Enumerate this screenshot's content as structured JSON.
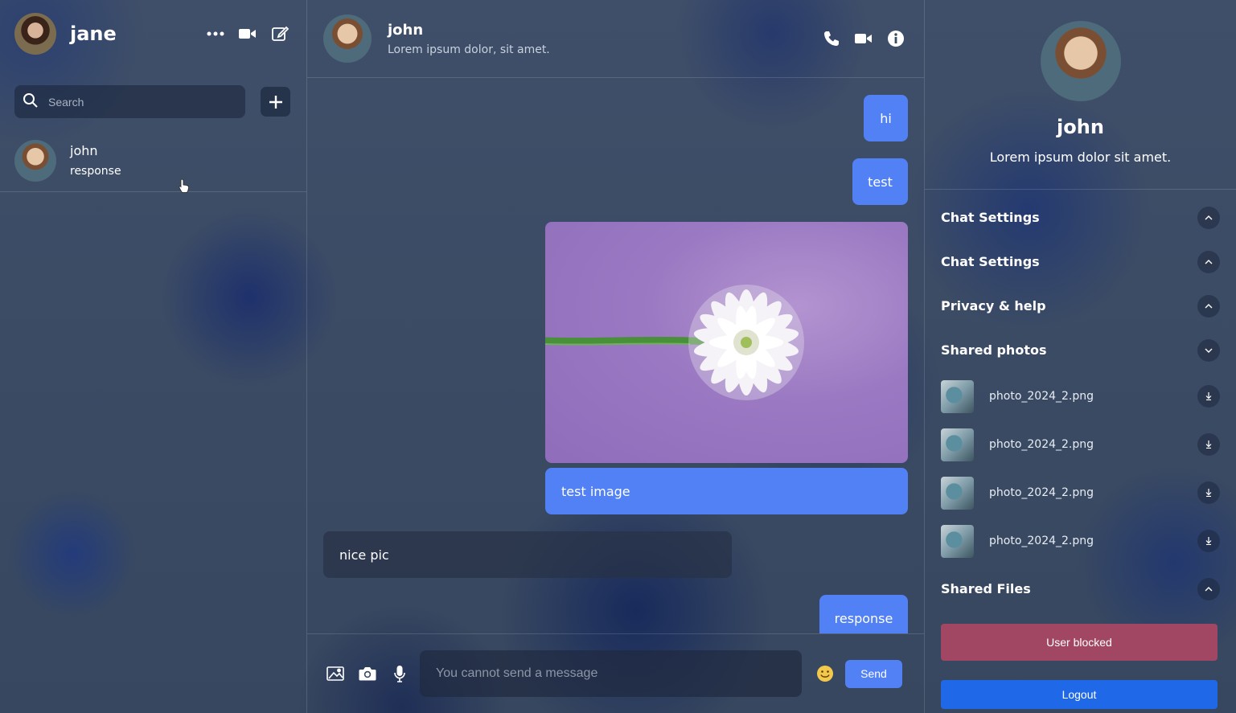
{
  "theme": {
    "accent": "#5181f5",
    "blocked": "#a14763",
    "logout": "#1f68e8"
  },
  "sidebar": {
    "user_name": "jane",
    "search_placeholder": "Search",
    "chats": [
      {
        "name": "john",
        "last_message": "response"
      }
    ]
  },
  "chat": {
    "contact_name": "john",
    "contact_status": "Lorem ipsum dolor, sit amet.",
    "messages": [
      {
        "from": "me",
        "text": "hi"
      },
      {
        "from": "me",
        "text": "test"
      },
      {
        "from": "me",
        "image": "white-flower-on-purple",
        "text": "test image"
      },
      {
        "from": "them",
        "text": "nice pic"
      },
      {
        "from": "me",
        "text": "response"
      }
    ],
    "composer_placeholder": "You cannot send a message",
    "send_label": "Send"
  },
  "details": {
    "name": "john",
    "bio": "Lorem ipsum dolor sit amet.",
    "sections": {
      "chat_settings_1": "Chat Settings",
      "chat_settings_2": "Chat Settings",
      "privacy": "Privacy & help",
      "shared_photos": "Shared photos",
      "shared_files": "Shared Files"
    },
    "photos": [
      "photo_2024_2.png",
      "photo_2024_2.png",
      "photo_2024_2.png",
      "photo_2024_2.png"
    ],
    "blocked_label": "User blocked",
    "logout_label": "Logout"
  }
}
